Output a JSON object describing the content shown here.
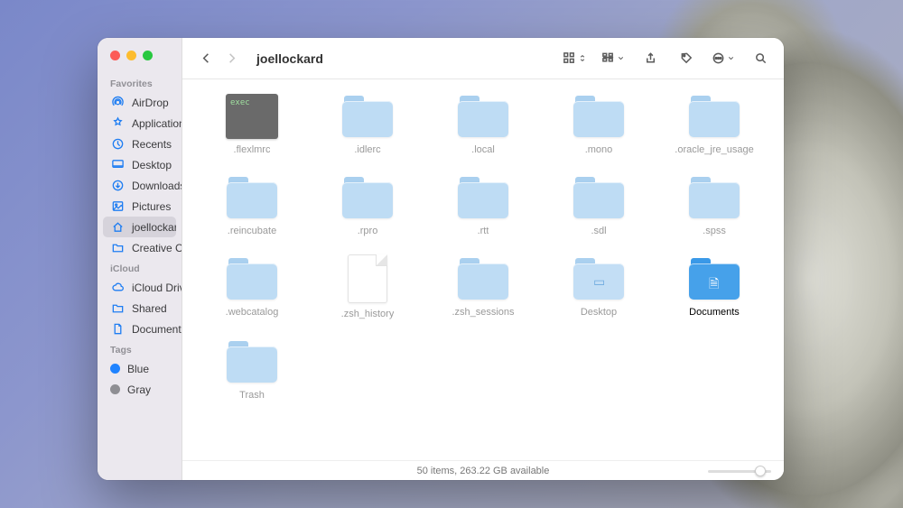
{
  "window": {
    "title": "joellockard"
  },
  "sidebar": {
    "sections": [
      {
        "label": "Favorites",
        "items": [
          {
            "icon": "airdrop-icon",
            "label": "AirDrop"
          },
          {
            "icon": "applications-icon",
            "label": "Applications"
          },
          {
            "icon": "recents-icon",
            "label": "Recents"
          },
          {
            "icon": "desktop-icon",
            "label": "Desktop"
          },
          {
            "icon": "downloads-icon",
            "label": "Downloads"
          },
          {
            "icon": "pictures-icon",
            "label": "Pictures"
          },
          {
            "icon": "home-icon",
            "label": "joellockard",
            "selected": true
          },
          {
            "icon": "folder-icon",
            "label": "Creative Clo…"
          }
        ]
      },
      {
        "label": "iCloud",
        "items": [
          {
            "icon": "cloud-icon",
            "label": "iCloud Drive"
          },
          {
            "icon": "shared-icon",
            "label": "Shared"
          },
          {
            "icon": "document-icon",
            "label": "Documents"
          }
        ]
      },
      {
        "label": "Tags",
        "items": [
          {
            "tag": "#1f83ff",
            "label": "Blue"
          },
          {
            "tag": "#8e8e93",
            "label": "Gray"
          }
        ]
      }
    ]
  },
  "items": [
    {
      "type": "exec",
      "name": ".flexlmrc"
    },
    {
      "type": "folder",
      "name": ".idlerc"
    },
    {
      "type": "folder",
      "name": ".local"
    },
    {
      "type": "folder",
      "name": ".mono"
    },
    {
      "type": "folder",
      "name": ".oracle_jre_usage"
    },
    {
      "type": "folder",
      "name": ".reincubate"
    },
    {
      "type": "folder",
      "name": ".rpro"
    },
    {
      "type": "folder",
      "name": ".rtt"
    },
    {
      "type": "folder",
      "name": ".sdl"
    },
    {
      "type": "folder",
      "name": ".spss"
    },
    {
      "type": "folder",
      "name": ".webcatalog"
    },
    {
      "type": "file",
      "name": ".zsh_history"
    },
    {
      "type": "folder",
      "name": ".zsh_sessions"
    },
    {
      "type": "sys",
      "name": "Desktop",
      "glyph": "▭"
    },
    {
      "type": "sys",
      "name": "Documents",
      "glyph": "🗎",
      "selected": true
    },
    {
      "type": "folder",
      "name": "Trash"
    }
  ],
  "status": {
    "text": "50 items, 263.22 GB available"
  },
  "icons": {
    "airdrop-icon": "<circle cx='8' cy='8' r='2.4'/><path d='M3.5 11.5a6 6 0 1 1 9 0'/><path d='M5.2 10.2a3.7 3.7 0 1 1 5.6 0'/>",
    "applications-icon": "<path d='M8 2l1.3 2.6L12 5 10 7l.5 2.8L8 8.6 5.5 9.8 6 7 4 5l2.7-.4z'/>",
    "recents-icon": "<circle cx='8' cy='8' r='5.5'/><path d='M8 4.5V8l2.3 2.3'/>",
    "desktop-icon": "<rect x='2' y='3' width='12' height='8' rx='1'/><path d='M2 9.5h12'/>",
    "downloads-icon": "<circle cx='8' cy='8' r='5.5'/><path d='M8 5v5M5.7 8.2 8 10.5l2.3-2.3'/>",
    "pictures-icon": "<rect x='2.5' y='3' width='11' height='10' rx='1'/><circle cx='6' cy='6.5' r='1.1'/><path d='M3 12l3.5-3.5 2 2L12 7l1.5 1.5'/>",
    "home-icon": "<path d='M3 8l5-4.5L13 8'/><path d='M4.5 7.5V13h7V7.5'/>",
    "folder-icon": "<path d='M2.5 4.5h4l1 1.5h6v6.5h-11z'/>",
    "cloud-icon": "<path d='M5 11.5a3 3 0 0 1 .3-6 3.5 3.5 0 0 1 6.7 1.3A2.3 2.3 0 0 1 11.7 11.5z'/>",
    "shared-icon": "<path d='M2.5 4.5h4l1 1.5h6v6.5h-11z'/>",
    "document-icon": "<path d='M4.5 2.5h5l2 2v9h-7z'/><path d='M9.5 2.5v2h2'/>",
    "back-icon": "<path d='M10 3 5 8l5 5'/>",
    "forward-icon": "<path d='M6 3l5 5-5 5'/>",
    "grid-icon": "<rect x='2' y='2' width='4' height='4'/><rect x='9' y='2' width='4' height='4'/><rect x='2' y='9' width='4' height='4'/><rect x='9' y='9' width='4' height='4'/>",
    "group-icon": "<rect x='2' y='2.5' width='4' height='3'/><rect x='9' y='2.5' width='4' height='3'/><rect x='2' y='8.5' width='4' height='3'/><rect x='9' y='8.5' width='4' height='3'/><path d='M2 7h12'/>",
    "share-icon": "<path d='M8 10V2.5M5.5 5 8 2.5 10.5 5'/><path d='M4 8v4.5h8V8'/>",
    "tag-icon": "<path d='M8 2.5l5 5-5.5 5.5-5-5V3z'/><circle cx='5' cy='5' r='1' fill='#5a5a5a'/>",
    "more-icon": "<circle cx='8' cy='8' r='5.5'/><circle cx='5.3' cy='8' r='.9' fill='#5a5a5a'/><circle cx='8' cy='8' r='.9' fill='#5a5a5a'/><circle cx='10.7' cy='8' r='.9' fill='#5a5a5a'/>",
    "chevrons-icon": "<path d='M5 6l3-2.5L11 6M5 10l3 2.5L11 10'/>",
    "chevron-down-icon": "<path d='M4 6l4 4 4-4'/>",
    "search-icon": "<circle cx='7' cy='7' r='4'/><path d='M10 10l3.5 3.5'/>"
  }
}
